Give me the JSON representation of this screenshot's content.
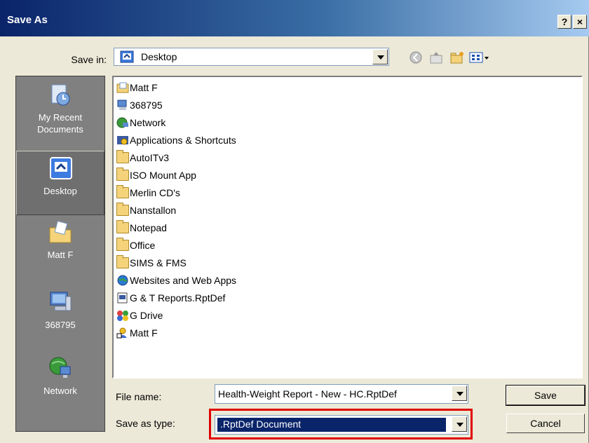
{
  "window": {
    "title": "Save As",
    "help_label": "?",
    "close_label": "×"
  },
  "save_in": {
    "label": "Save in:",
    "value": "Desktop"
  },
  "places": [
    {
      "label": "My Recent Documents",
      "icon": "recent-documents-icon"
    },
    {
      "label": "Desktop",
      "icon": "desktop-icon",
      "selected": true
    },
    {
      "label": "Matt F",
      "icon": "my-documents-icon"
    },
    {
      "label": "368795",
      "icon": "my-computer-icon"
    },
    {
      "label": "Network",
      "icon": "network-icon"
    }
  ],
  "files": [
    {
      "name": "Matt F",
      "icon": "user-folder-icon"
    },
    {
      "name": "368795",
      "icon": "computer-icon"
    },
    {
      "name": "Network",
      "icon": "network-icon"
    },
    {
      "name": "Applications & Shortcuts",
      "icon": "shortcut-folder-icon"
    },
    {
      "name": "AutoITv3",
      "icon": "folder-icon"
    },
    {
      "name": "ISO Mount App",
      "icon": "folder-icon"
    },
    {
      "name": "Merlin CD's",
      "icon": "folder-icon"
    },
    {
      "name": "Nanstallon",
      "icon": "folder-icon"
    },
    {
      "name": "Notepad",
      "icon": "folder-icon"
    },
    {
      "name": "Office",
      "icon": "folder-icon"
    },
    {
      "name": "SIMS & FMS",
      "icon": "folder-icon"
    },
    {
      "name": "Websites and Web Apps",
      "icon": "globe-icon"
    },
    {
      "name": "G & T Reports.RptDef",
      "icon": "rptdef-file-icon"
    },
    {
      "name": "G Drive",
      "icon": "network-drive-icon"
    },
    {
      "name": "Matt F",
      "icon": "user-shortcut-icon"
    }
  ],
  "file_name": {
    "label": "File name:",
    "value": "Health-Weight Report - New - HC.RptDef"
  },
  "save_as_type": {
    "label": "Save as type:",
    "value": ".RptDef Document"
  },
  "buttons": {
    "save": "Save",
    "cancel": "Cancel"
  },
  "colors": {
    "title_bar": "#0a246a",
    "highlight": "#0a246a",
    "annotation": "#e00000",
    "places_bar": "#808080"
  }
}
